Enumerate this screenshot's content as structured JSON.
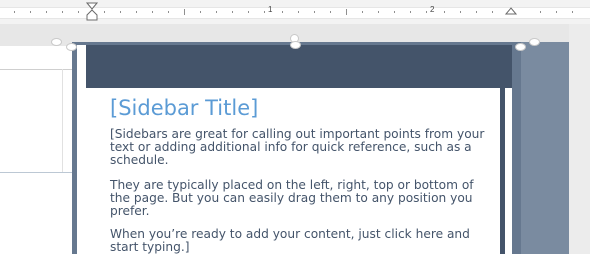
{
  "ruler": {
    "numbers": [
      "1",
      "2"
    ]
  },
  "sidebar": {
    "title": "[Sidebar Title]",
    "paragraphs": [
      "[Sidebars are great for calling out important points from your text or adding additional info for quick reference, such as a schedule.",
      "They are typically placed on the left, right, top or bottom of the page. But you can easily drag them to any position you prefer.",
      "When you’re ready to add your content, just click here and start typing.]"
    ]
  },
  "colors": {
    "header_band": "#44546a",
    "title_text": "#5b9bd5",
    "body_text": "#44546a",
    "frame": "#66788f"
  }
}
